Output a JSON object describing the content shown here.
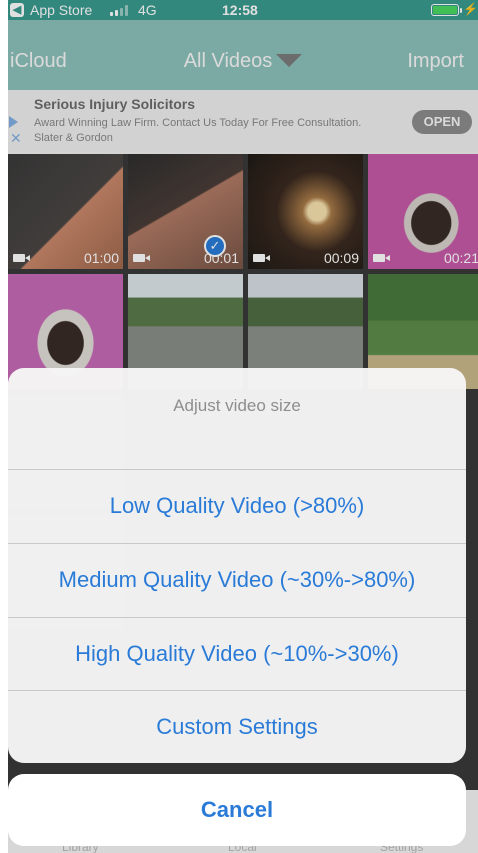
{
  "status_bar": {
    "back_icon": "back-arrow-icon",
    "app": "App Store",
    "network": "4G",
    "time": "12:58",
    "battery_color": "#4cd964"
  },
  "nav": {
    "left": "iCloud",
    "title": "All Videos",
    "right": "Import",
    "bg_color": "#3a9b8f"
  },
  "ad": {
    "title": "Serious Injury Solicitors",
    "body": "Award Winning Law Firm. Contact Us Today For Free Consultation. Slater & Gordon",
    "open": "OPEN"
  },
  "videos": [
    {
      "duration": "01:00",
      "selected": false
    },
    {
      "duration": "00:01",
      "selected": true
    },
    {
      "duration": "00:09",
      "selected": false
    },
    {
      "duration": "00:21",
      "selected": false
    }
  ],
  "sheet": {
    "title": "Adjust video size",
    "options": [
      "Low Quality Video (>80%)",
      "Medium Quality Video (~30%->80%)",
      "High Quality Video (~10%->30%)",
      "Custom Settings"
    ],
    "cancel": "Cancel",
    "accent_color": "#2a7bd8"
  },
  "tabs": [
    "Library",
    "Local",
    "Settings"
  ]
}
